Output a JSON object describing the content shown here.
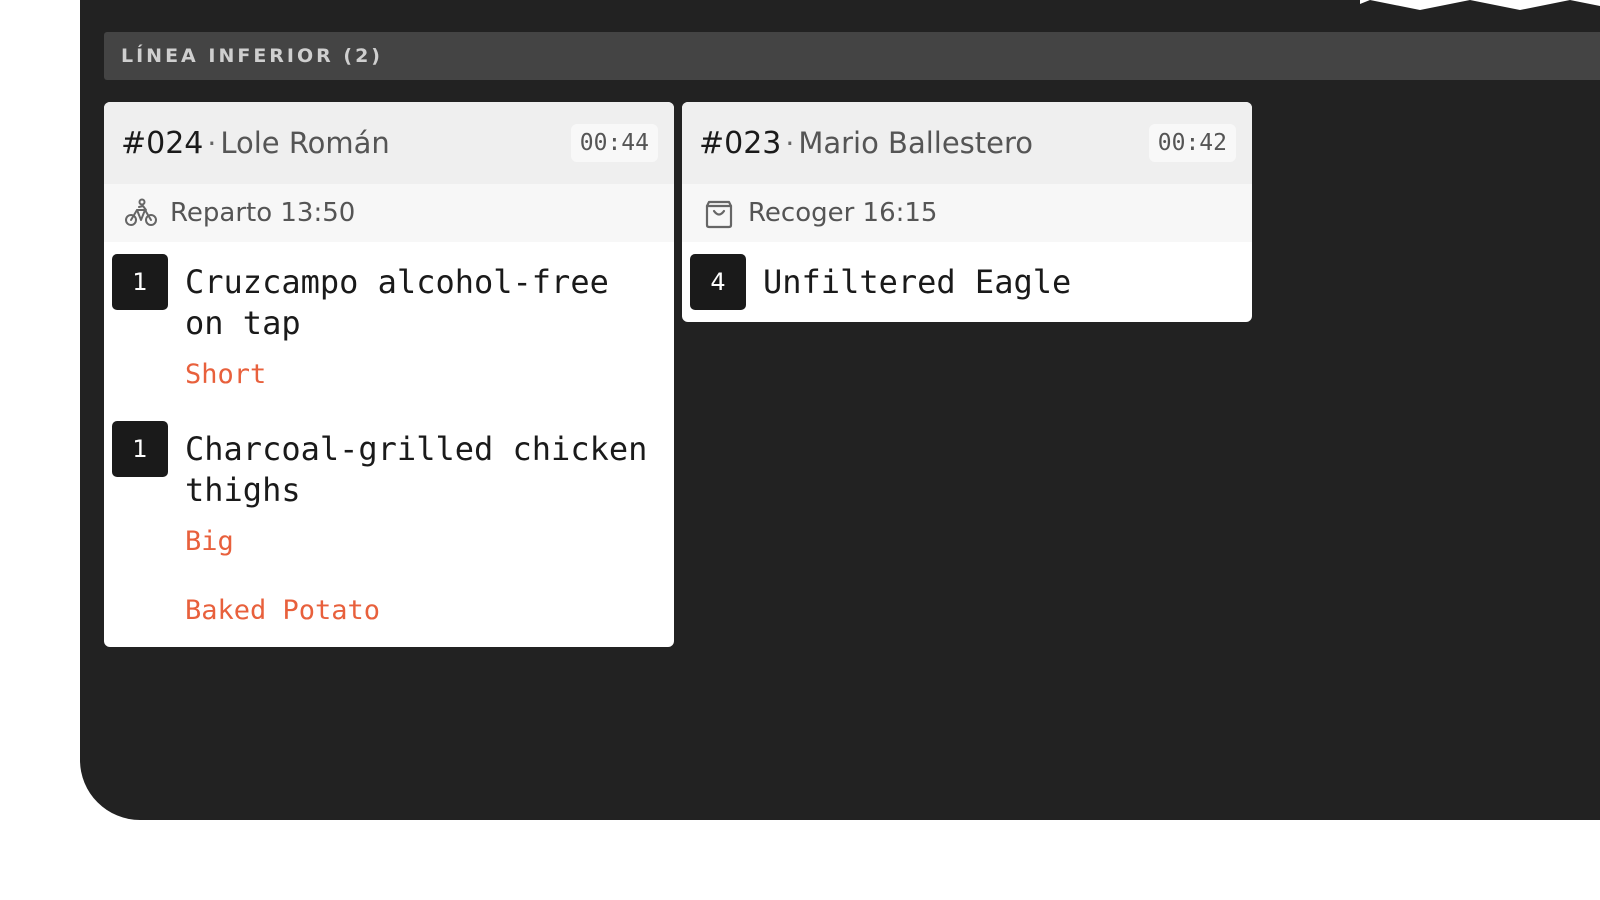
{
  "section": {
    "title": "LÍNEA INFERIOR (2)"
  },
  "tickets": [
    {
      "number": "#024",
      "customer": "Lole Román",
      "timer": "00:44",
      "type_icon": "bicycle-delivery-icon",
      "type_label": "Reparto 13:50",
      "items": [
        {
          "qty": "1",
          "name": "Cruzcampo alcohol-free on tap",
          "modifiers": [
            "Short"
          ]
        },
        {
          "qty": "1",
          "name": "Charcoal-grilled chicken thighs",
          "modifiers": [
            "Big",
            "Baked Potato"
          ]
        }
      ]
    },
    {
      "number": "#023",
      "customer": "Mario Ballestero",
      "timer": "00:42",
      "type_icon": "shopping-bag-icon",
      "type_label": "Recoger 16:15",
      "items": [
        {
          "qty": "4",
          "name": "Unfiltered Eagle",
          "modifiers": []
        }
      ]
    }
  ],
  "colors": {
    "background": "#222222",
    "section_bar": "#444444",
    "modifier": "#e8603c",
    "qty_badge": "#1a1a1a"
  }
}
